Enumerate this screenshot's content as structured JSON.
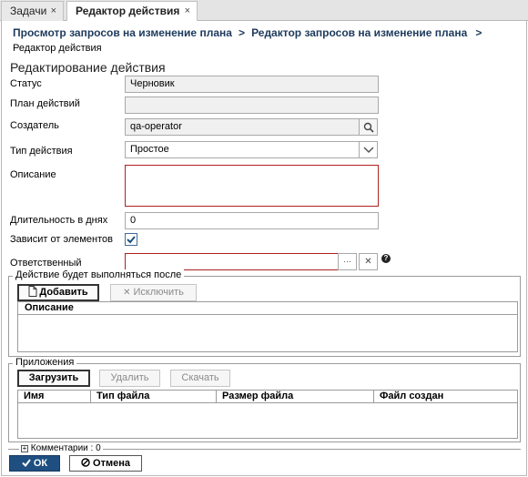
{
  "tabs": [
    {
      "label": "Задачи",
      "close": "×"
    },
    {
      "label": "Редактор действия",
      "close": "×"
    }
  ],
  "breadcrumb": {
    "items": [
      "Просмотр запросов на изменение плана",
      "Редактор запросов на изменение плана"
    ],
    "separator": ">",
    "current": "Редактор действия"
  },
  "form": {
    "title": "Редактирование действия",
    "status_label": "Статус",
    "status_value": "Черновик",
    "plan_label": "План действий",
    "plan_value": "",
    "creator_label": "Создатель",
    "creator_value": "qa-operator",
    "type_label": "Тип действия",
    "type_value": "Простое",
    "description_label": "Описание",
    "description_value": "",
    "duration_label": "Длительность в днях",
    "duration_value": "0",
    "depends_label": "Зависит от элементов",
    "depends_checked": true,
    "responsible_label": "Ответственный",
    "responsible_value": "",
    "browse_glyph": "···",
    "clear_glyph": "✕",
    "help_glyph": "?"
  },
  "after_group": {
    "legend": "Действие будет выполняться после",
    "add_label": "Добавить",
    "exclude_label": "Исключить",
    "columns": [
      "Описание"
    ]
  },
  "attachments": {
    "legend": "Приложения",
    "upload_label": "Загрузить",
    "delete_label": "Удалить",
    "download_label": "Скачать",
    "columns": [
      "Имя",
      "Тип файла",
      "Размер файла",
      "Файл создан"
    ]
  },
  "comments": {
    "label": "Комментарии : 0"
  },
  "footer": {
    "ok_label": "ОК",
    "cancel_label": "Отмена"
  },
  "colors": {
    "accent": "#1e4f80",
    "required_border": "#b02020",
    "breadcrumb": "#1d3a5c"
  }
}
